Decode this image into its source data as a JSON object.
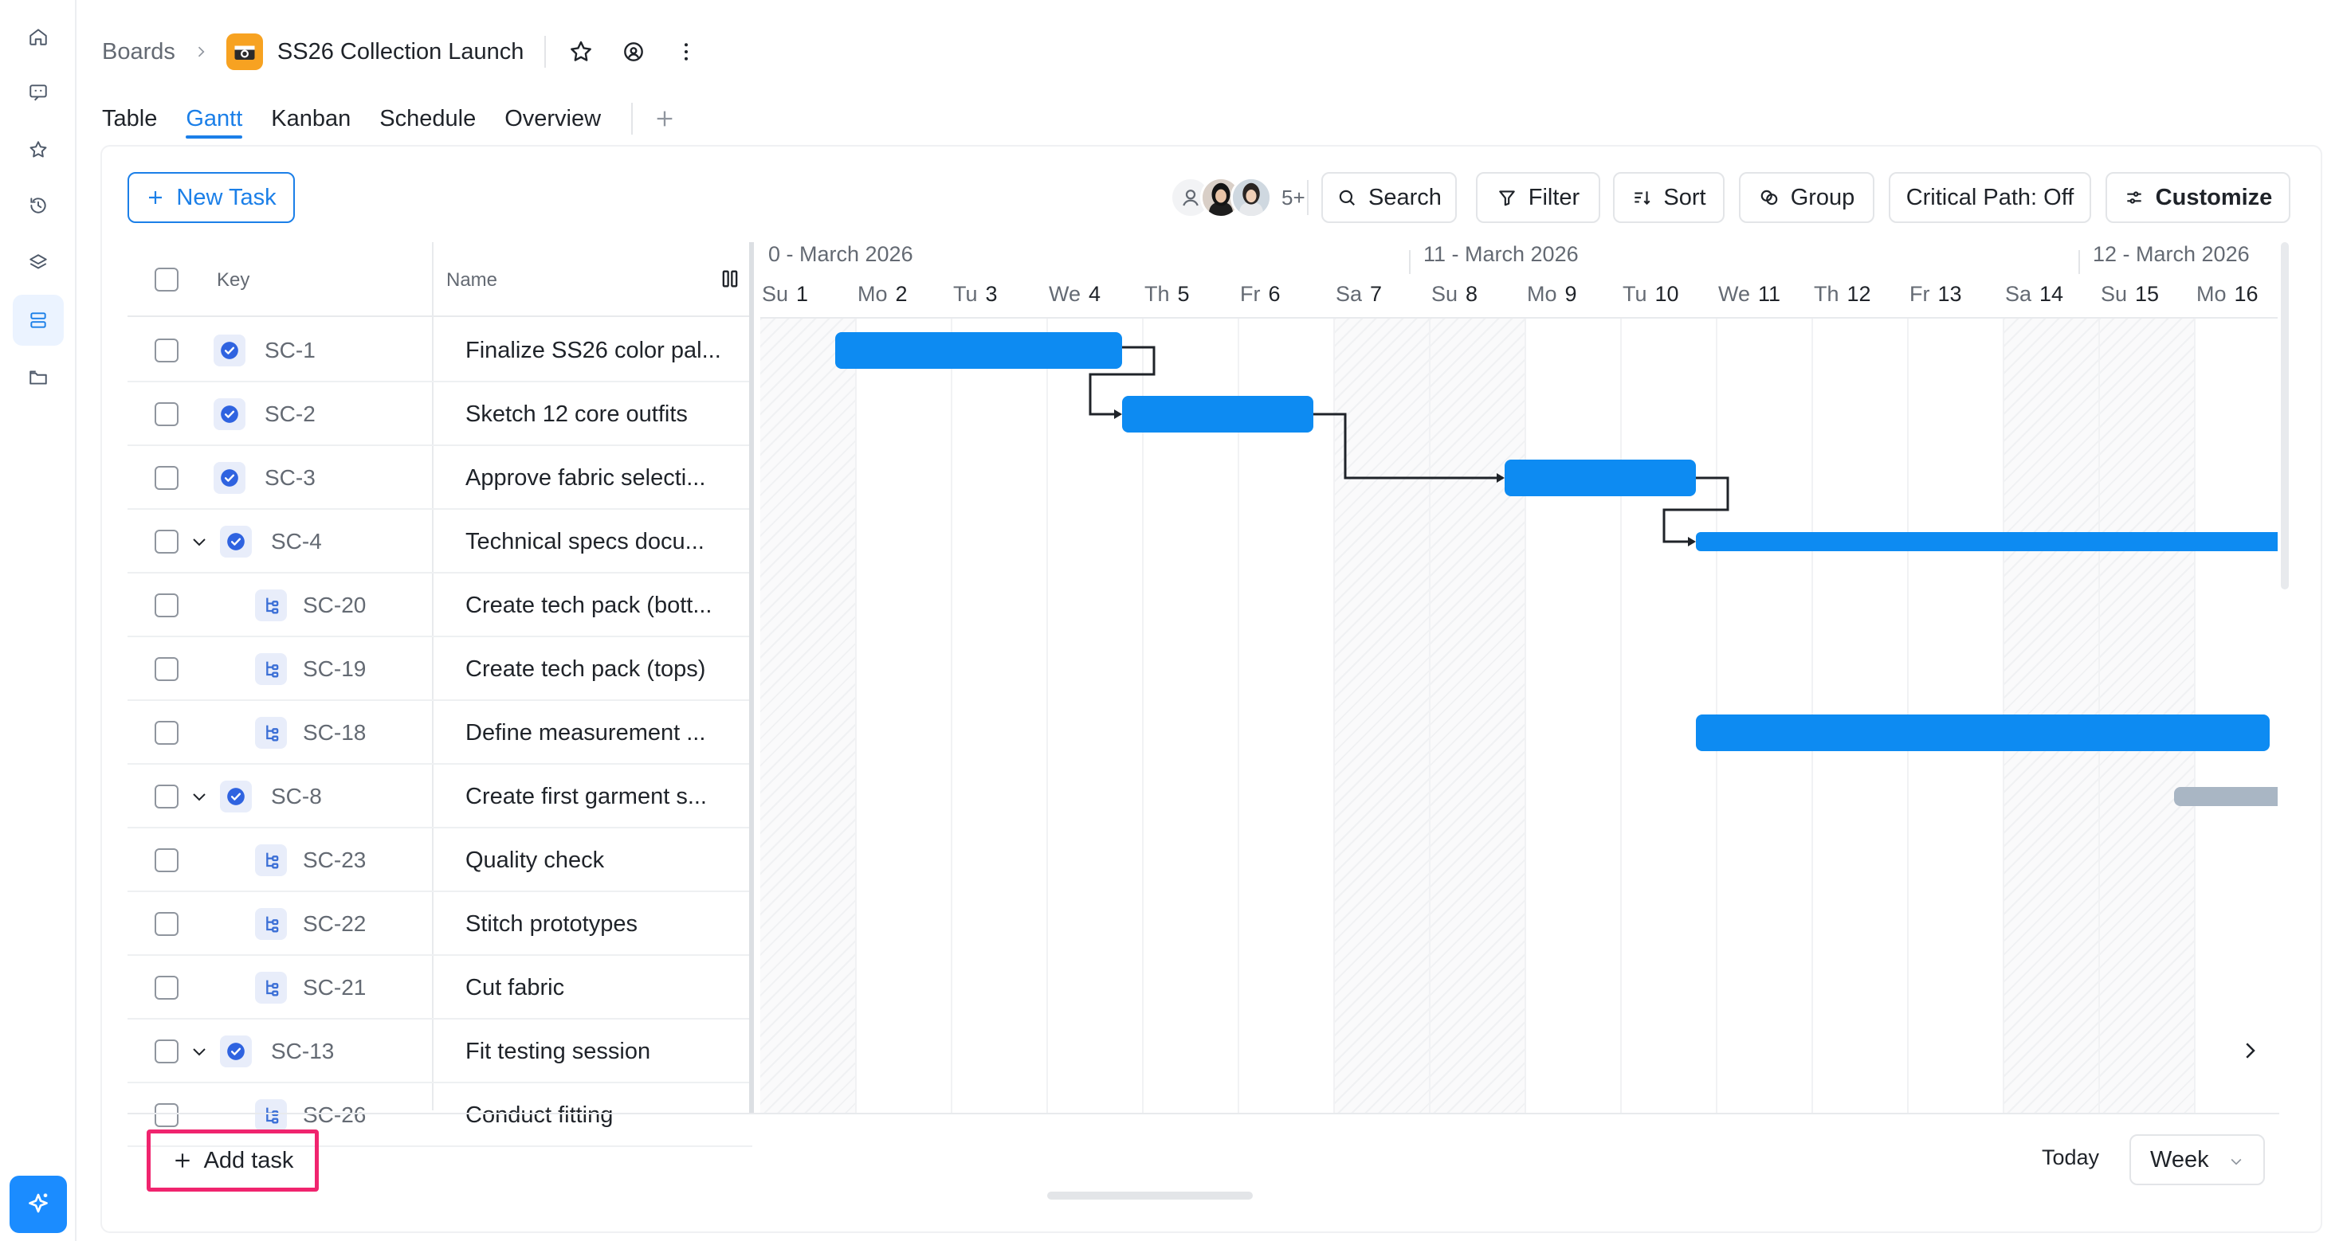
{
  "breadcrumb": {
    "root": "Boards",
    "title": "SS26 Collection Launch"
  },
  "tabs": [
    {
      "label": "Table",
      "active": false
    },
    {
      "label": "Gantt",
      "active": true
    },
    {
      "label": "Kanban",
      "active": false
    },
    {
      "label": "Schedule",
      "active": false
    },
    {
      "label": "Overview",
      "active": false
    }
  ],
  "toolbar": {
    "new_task": "New Task",
    "avatars_more": "5+",
    "search": "Search",
    "filter": "Filter",
    "sort": "Sort",
    "group": "Group",
    "critical_path": "Critical Path: Off",
    "customize": "Customize"
  },
  "grid": {
    "key_header": "Key",
    "name_header": "Name",
    "rows": [
      {
        "key": "SC-1",
        "name": "Finalize SS26 color pal...",
        "type": "task",
        "expand": false
      },
      {
        "key": "SC-2",
        "name": "Sketch 12 core outfits",
        "type": "task",
        "expand": false
      },
      {
        "key": "SC-3",
        "name": "Approve fabric selecti...",
        "type": "task",
        "expand": false
      },
      {
        "key": "SC-4",
        "name": "Technical specs docu...",
        "type": "task",
        "expand": true
      },
      {
        "key": "SC-20",
        "name": "Create tech pack (bott...",
        "type": "subtask",
        "expand": false
      },
      {
        "key": "SC-19",
        "name": "Create tech pack (tops)",
        "type": "subtask",
        "expand": false
      },
      {
        "key": "SC-18",
        "name": "Define measurement ...",
        "type": "subtask",
        "expand": false
      },
      {
        "key": "SC-8",
        "name": "Create first garment s...",
        "type": "task",
        "expand": true
      },
      {
        "key": "SC-23",
        "name": "Quality check",
        "type": "subtask",
        "expand": false
      },
      {
        "key": "SC-22",
        "name": "Stitch prototypes",
        "type": "subtask",
        "expand": false
      },
      {
        "key": "SC-21",
        "name": "Cut fabric",
        "type": "subtask",
        "expand": false
      },
      {
        "key": "SC-13",
        "name": "Fit testing session",
        "type": "task",
        "expand": true
      },
      {
        "key": "SC-26",
        "name": "Conduct fitting",
        "type": "subtask",
        "expand": false
      }
    ]
  },
  "gantt": {
    "weeks": [
      "0 - March 2026",
      "11 - March 2026",
      "12 - March 2026"
    ],
    "days": [
      {
        "dow": "Su",
        "num": "1"
      },
      {
        "dow": "Mo",
        "num": "2"
      },
      {
        "dow": "Tu",
        "num": "3"
      },
      {
        "dow": "We",
        "num": "4"
      },
      {
        "dow": "Th",
        "num": "5"
      },
      {
        "dow": "Fr",
        "num": "6"
      },
      {
        "dow": "Sa",
        "num": "7"
      },
      {
        "dow": "Su",
        "num": "8"
      },
      {
        "dow": "Mo",
        "num": "9"
      },
      {
        "dow": "Tu",
        "num": "10"
      },
      {
        "dow": "We",
        "num": "11"
      },
      {
        "dow": "Th",
        "num": "12"
      },
      {
        "dow": "Fr",
        "num": "13"
      },
      {
        "dow": "Sa",
        "num": "14"
      },
      {
        "dow": "Su",
        "num": "15"
      },
      {
        "dow": "Mo",
        "num": "16"
      }
    ]
  },
  "footer": {
    "add_task": "Add task",
    "today": "Today",
    "scale": "Week"
  },
  "colors": {
    "accent": "#1b7fe8",
    "bar": "#0d8bf2",
    "bar_inactive": "#a9b6c4",
    "highlight": "#f0246e"
  }
}
